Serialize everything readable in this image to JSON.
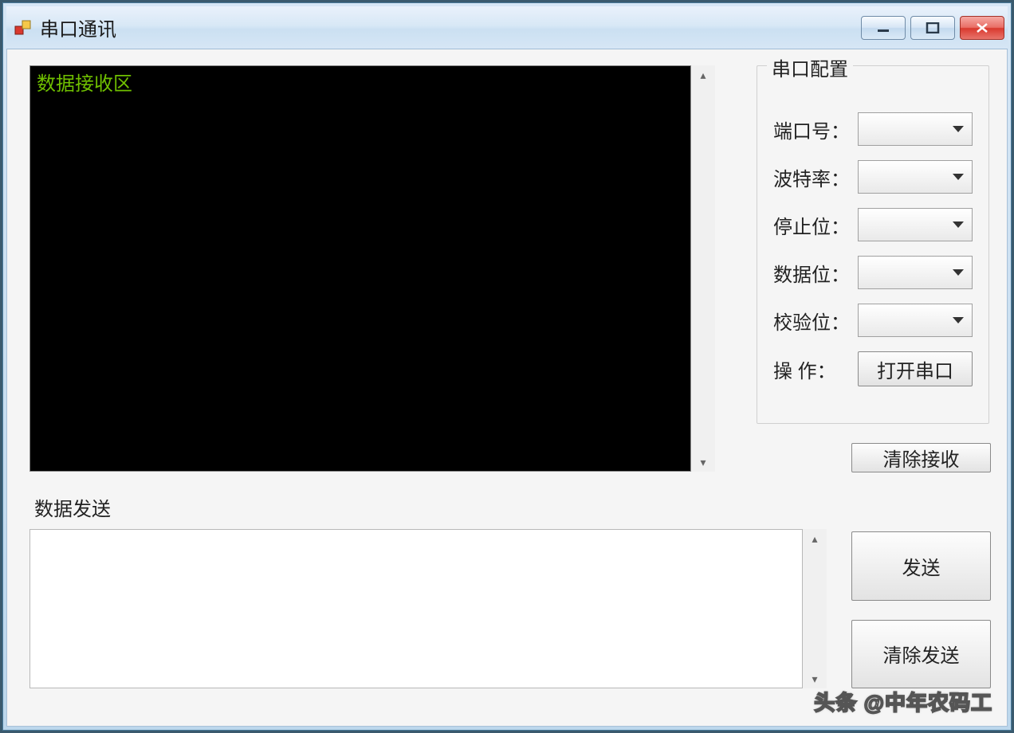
{
  "window": {
    "title": "串口通讯"
  },
  "receive": {
    "placeholder_text": "数据接收区"
  },
  "config": {
    "legend": "串口配置",
    "port_label": "端口号：",
    "baud_label": "波特率：",
    "stopbits_label": "停止位：",
    "databits_label": "数据位：",
    "parity_label": "校验位：",
    "operate_label": "操  作：",
    "open_button": "打开串口",
    "port_value": "",
    "baud_value": "",
    "stopbits_value": "",
    "databits_value": "",
    "parity_value": ""
  },
  "buttons": {
    "clear_receive": "清除接收",
    "send": "发送",
    "clear_send": "清除发送"
  },
  "send": {
    "legend": "数据发送",
    "value": ""
  },
  "watermark": "头条 @中年农码工"
}
